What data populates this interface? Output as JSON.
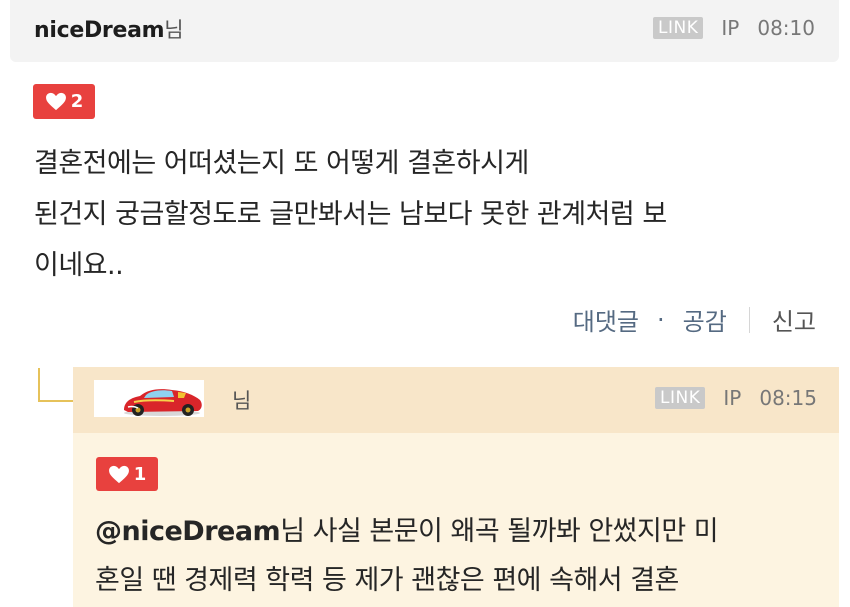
{
  "comment": {
    "author": "niceDream",
    "honorific": "님",
    "link_label": "LINK",
    "ip_label": "IP",
    "time": "08:10",
    "likes": "2",
    "body": "결혼전에는 어떠셨는지 또 어떻게 결혼하시게\n된건지 궁금할정도로 글만봐서는 남보다 못한 관계처럼 보\n이네요..",
    "actions": {
      "reply": "대댓글",
      "dot": "·",
      "like": "공감",
      "report": "신고"
    }
  },
  "reply": {
    "honorific": "님",
    "link_label": "LINK",
    "ip_label": "IP",
    "time": "08:15",
    "likes": "1",
    "mention": "@niceDream",
    "body": "님 사실 본문이 왜곡 될까봐 안썼지만 미\n혼일 땐 경제력 학력 등 제가 괜찮은 편에 속해서 결혼",
    "avatar_icon": "red-race-car-image"
  },
  "colors": {
    "like_badge": "#e8413e",
    "reply_header": "#f8e6c9",
    "reply_body": "#fdf4e1",
    "action_text": "#556a82"
  }
}
